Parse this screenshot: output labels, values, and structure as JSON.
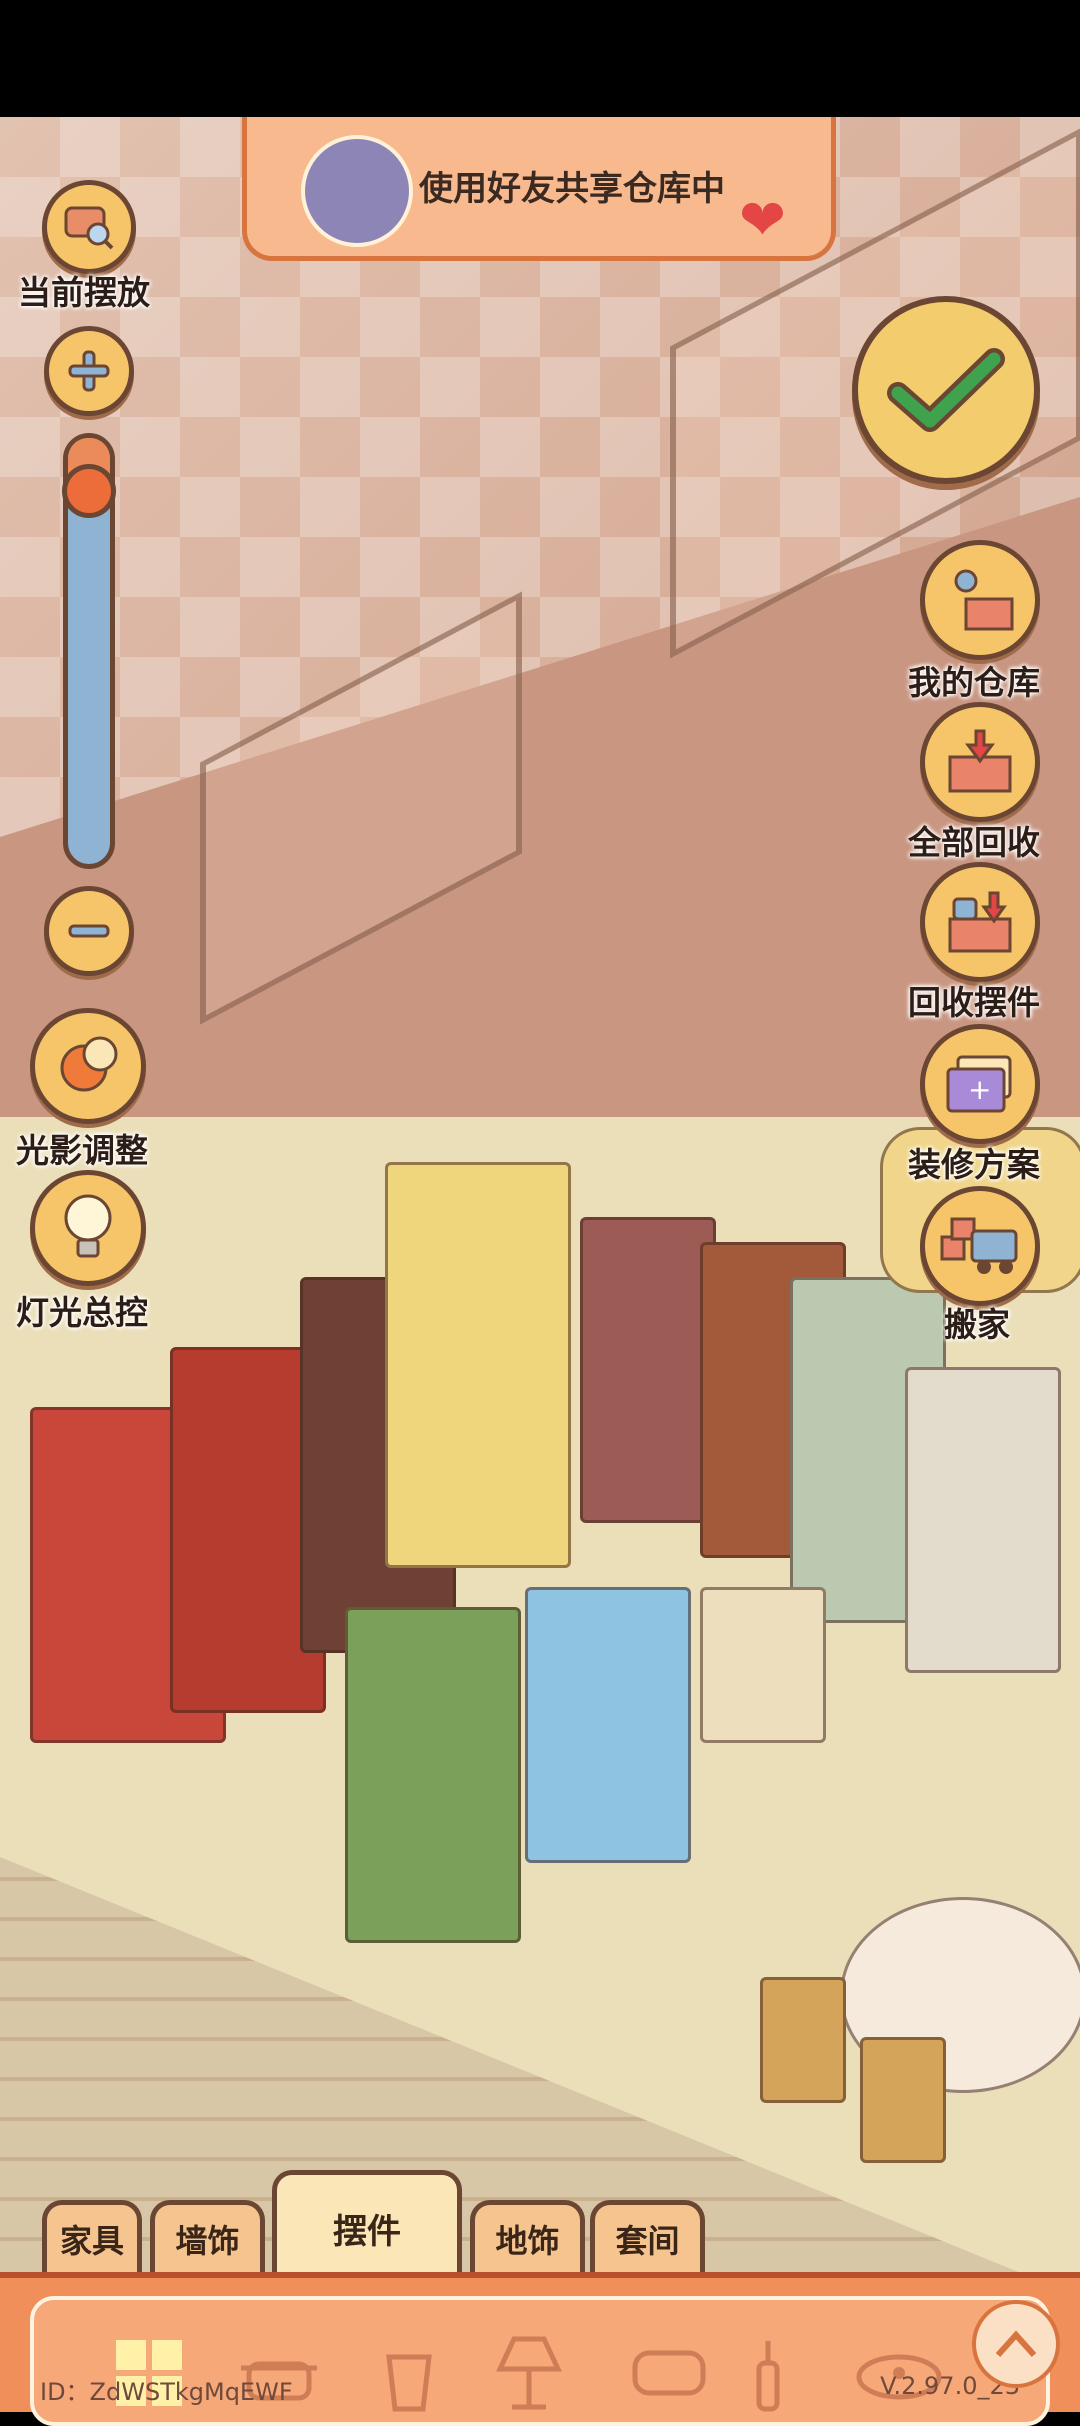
{
  "banner": {
    "text": "使用好友共享仓库中"
  },
  "left_controls": {
    "current_place_label": "当前摆放",
    "zoom_in_icon": "plus-icon",
    "zoom_out_icon": "minus-icon",
    "zoom_level": 0.93,
    "light_shadow_label": "光影调整",
    "light_master_label": "灯光总控"
  },
  "right_controls": {
    "confirm_icon": "checkmark-icon",
    "items": [
      {
        "label": "我的仓库",
        "icon": "warehouse-icon"
      },
      {
        "label": "全部回收",
        "icon": "recycle-all-icon"
      },
      {
        "label": "回收摆件",
        "icon": "recycle-decor-icon"
      },
      {
        "label": "装修方案",
        "icon": "renovation-plan-icon"
      },
      {
        "label": "搬家",
        "icon": "moving-truck-icon"
      }
    ]
  },
  "tabs": [
    {
      "label": "家具"
    },
    {
      "label": "墙饰"
    },
    {
      "label": "摆件",
      "active": true
    },
    {
      "label": "地饰"
    },
    {
      "label": "套间"
    }
  ],
  "categories": [
    "grid-icon",
    "pot-icon",
    "cup-icon",
    "lamp-icon",
    "pillow-icon",
    "bottle-icon",
    "pet-bowl-icon"
  ],
  "footer": {
    "id_text": "ID：ZdWSTkgMqEWF",
    "version_text": "V.2.97.0_23"
  },
  "colors": {
    "accent_orange": "#f08f5a",
    "button_gold": "#f6c56a",
    "outline_brown": "#6b4633",
    "check_green": "#3fa34d"
  }
}
